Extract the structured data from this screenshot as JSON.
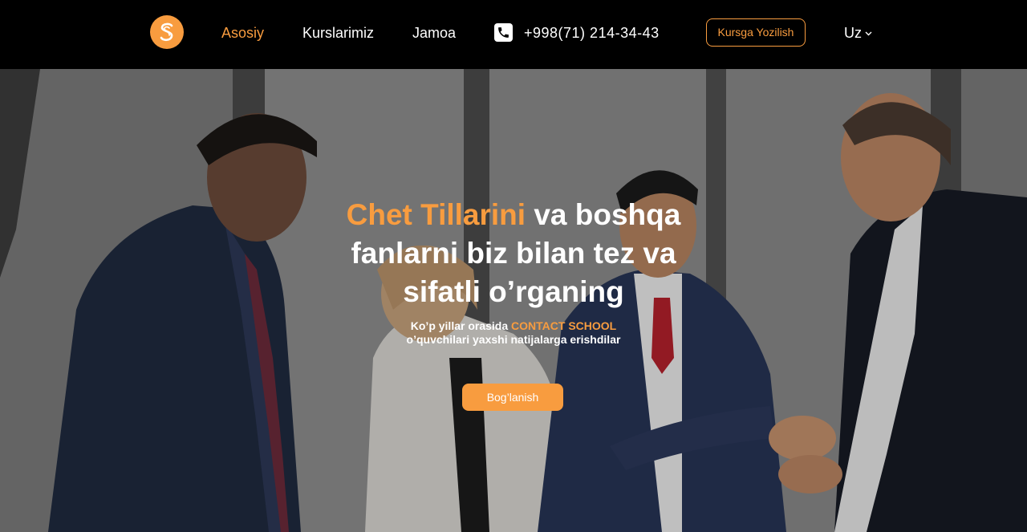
{
  "header": {
    "nav": {
      "home": "Asosiy",
      "courses": "Kurslarimiz",
      "team": "Jamoa"
    },
    "phone": "+998(71) 214-34-43",
    "enroll_button": "Kursga Yozilish",
    "language": "Uz"
  },
  "hero": {
    "headline_accent": "Chet Tillarini",
    "headline_line1_rest": " va boshqa",
    "headline_line2": "fanlarni biz bilan tez va",
    "headline_line3": "sifatli o’rganing",
    "sub_prefix": "Ko’p yillar orasida ",
    "sub_accent": "CONTACT SCHOOL",
    "sub_line2": "o’quvchilari yaxshi natijalarga erishdilar",
    "cta_button": "Bog’lanish"
  },
  "colors": {
    "accent": "#F89C3F",
    "header_bg": "#000000",
    "text": "#FFFFFF"
  },
  "icons": {
    "logo": "s-logo-icon",
    "phone": "phone-icon",
    "lang_dropdown": "chevron-down-icon"
  }
}
